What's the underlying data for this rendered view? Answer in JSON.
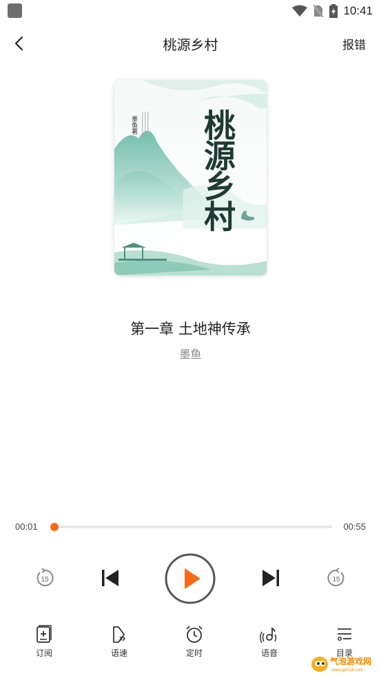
{
  "status_bar": {
    "time": "10:41"
  },
  "header": {
    "title": "桃源乡村",
    "report_label": "报错"
  },
  "book": {
    "cover_title": "桃源乡村",
    "cover_author": "墨鱼著",
    "chapter_title": "第一章 土地神传承",
    "author": "墨鱼"
  },
  "player": {
    "current_time": "00:01",
    "total_time": "00:55",
    "progress": 0.015,
    "rewind_seconds": "15",
    "forward_seconds": "15",
    "accent_color": "#f86b14"
  },
  "bottom_tabs": [
    {
      "label": "订阅",
      "icon": "subscribe-icon"
    },
    {
      "label": "语速",
      "icon": "speed-icon"
    },
    {
      "label": "定时",
      "icon": "alarm-clock-icon"
    },
    {
      "label": "语音",
      "icon": "voice-icon"
    },
    {
      "label": "目录",
      "icon": "catalog-icon"
    }
  ],
  "watermark": {
    "text": "气泡游戏网",
    "subtext": "www.qpm28.com"
  }
}
